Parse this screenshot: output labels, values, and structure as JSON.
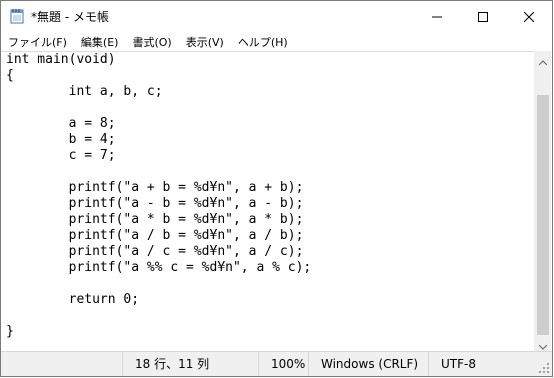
{
  "window": {
    "title": "*無題 - メモ帳",
    "app_icon": "notepad-icon",
    "controls": [
      "minimize-icon",
      "maximize-icon",
      "close-icon"
    ]
  },
  "menu": {
    "items": [
      {
        "label": "ファイル(F)"
      },
      {
        "label": "編集(E)"
      },
      {
        "label": "書式(O)"
      },
      {
        "label": "表示(V)"
      },
      {
        "label": "ヘルプ(H)"
      }
    ]
  },
  "editor": {
    "lines": [
      "int main(void)",
      "{",
      "        int a, b, c;",
      "",
      "        a = 8;",
      "        b = 4;",
      "        c = 7;",
      "",
      "        printf(\"a + b = %d¥n\", a + b);",
      "        printf(\"a - b = %d¥n\", a - b);",
      "        printf(\"a * b = %d¥n\", a * b);",
      "        printf(\"a / b = %d¥n\", a / b);",
      "        printf(\"a / c = %d¥n\", a / c);",
      "        printf(\"a %% c = %d¥n\", a % c);",
      "",
      "        return 0;",
      "",
      "}"
    ]
  },
  "status": {
    "position": "18 行、11 列",
    "zoom": "100%",
    "line_ending": "Windows (CRLF)",
    "encoding": "UTF-8"
  }
}
